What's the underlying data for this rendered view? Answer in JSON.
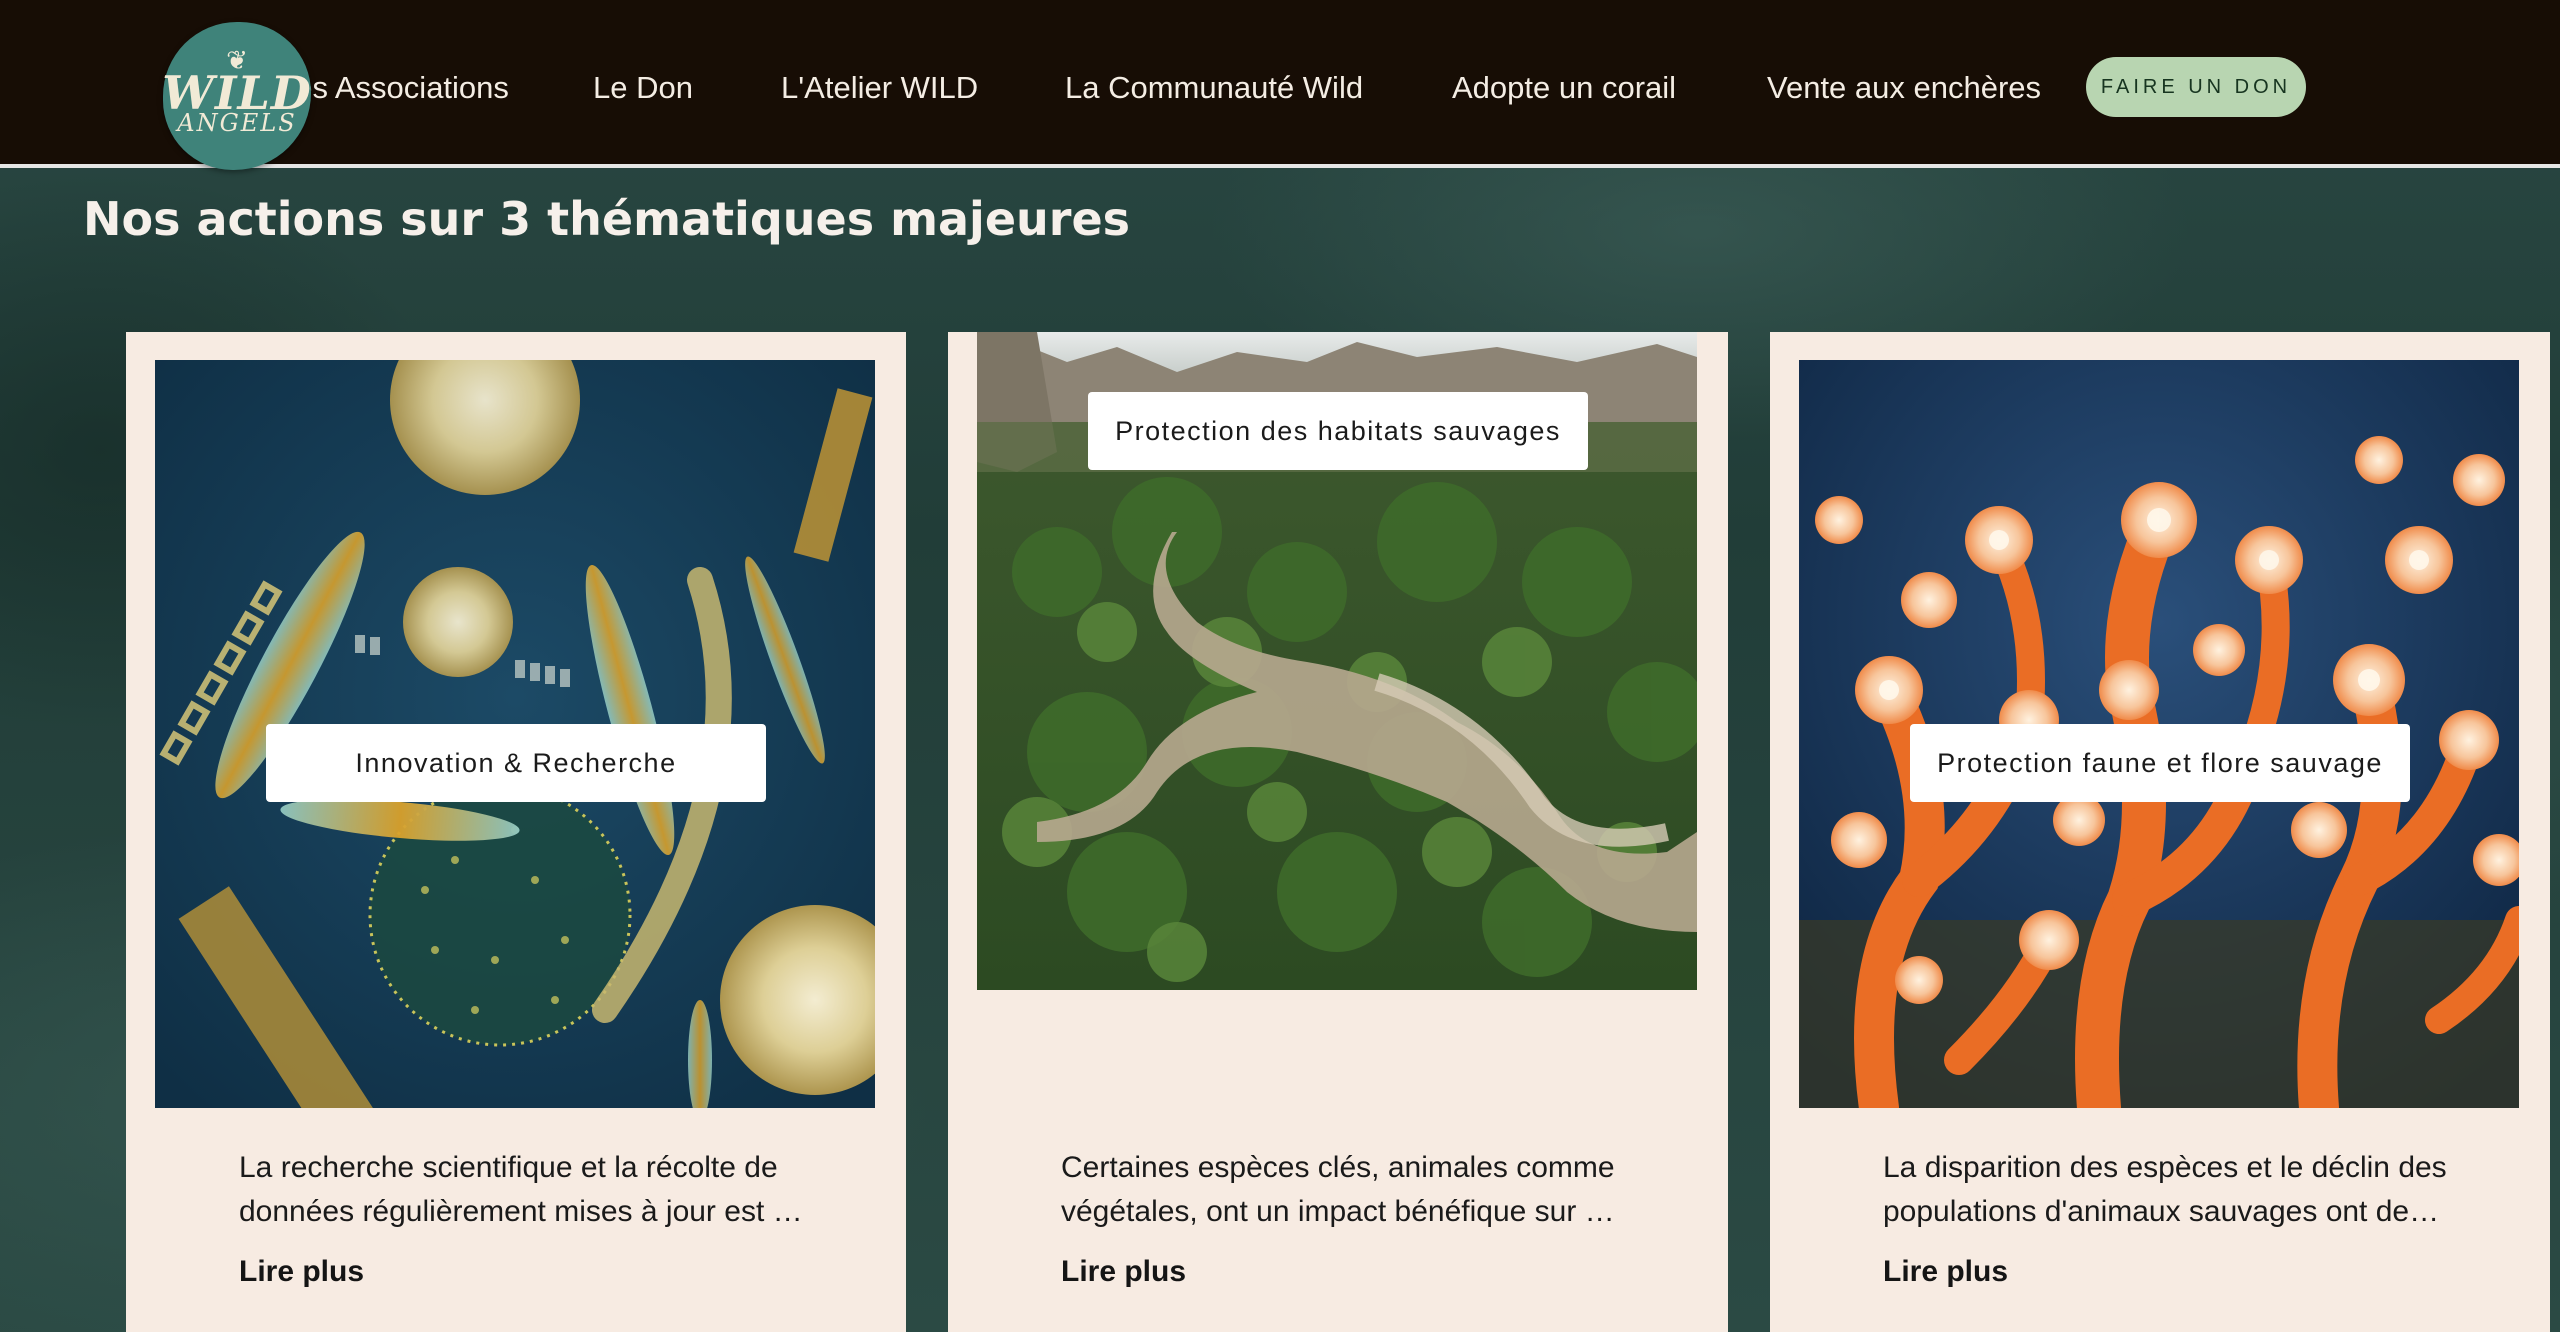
{
  "header": {
    "logo": {
      "word1": "WILD",
      "word2": "ANGELS",
      "leaf": "❦"
    },
    "nav": [
      {
        "label": "Les Associations"
      },
      {
        "label": "Le Don"
      },
      {
        "label": "L'Atelier WILD"
      },
      {
        "label": "La Communauté Wild"
      },
      {
        "label": "Adopte un corail"
      },
      {
        "label": "Vente aux enchères"
      }
    ],
    "donate_label": "FAIRE UN DON"
  },
  "section": {
    "title": "Nos actions sur 3 thématiques majeures"
  },
  "cards": [
    {
      "tag": "Innovation & Recherche",
      "image": "plankton-microscopy-image",
      "excerpt": "La recherche scientifique et la récolte de données régulièrement mises à jour est …",
      "more": "Lire plus"
    },
    {
      "tag": "Protection des habitats sauvages",
      "image": "river-forest-aerial-image",
      "excerpt": "Certaines espèces clés, animales comme végétales, ont un impact bénéfique sur …",
      "more": "Lire plus"
    },
    {
      "tag": "Protection faune et flore sauvage",
      "image": "orange-coral-image",
      "excerpt": "La disparition des espèces et le déclin des populations d'animaux sauvages ont de…",
      "more": "Lire plus"
    }
  ],
  "colors": {
    "header_bg": "#170d05",
    "accent_green": "#b8d5b1",
    "card_bg": "#f7ebe2",
    "logo_bg": "#3f837a",
    "page_bg": "#1f3b37"
  }
}
